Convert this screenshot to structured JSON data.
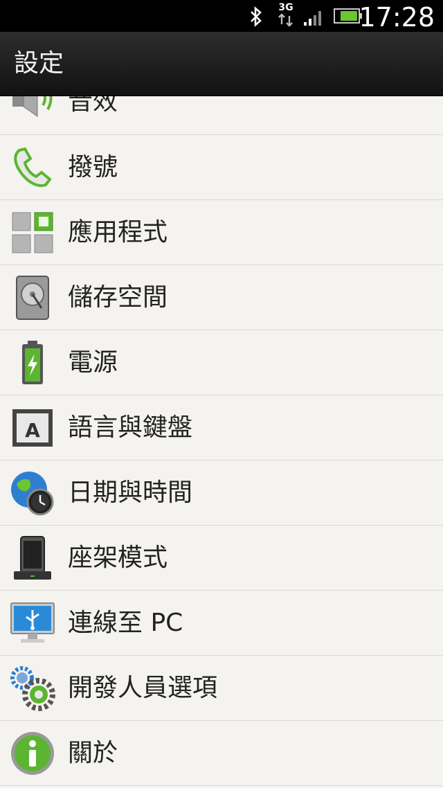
{
  "status": {
    "time": "17:28",
    "network": "3G",
    "icons": [
      "bluetooth-icon",
      "3g-data-icon",
      "signal-icon",
      "battery-icon"
    ]
  },
  "header": {
    "title": "設定"
  },
  "settings": {
    "items": [
      {
        "label": "音效",
        "icon": "speaker-icon"
      },
      {
        "label": "撥號",
        "icon": "phone-icon"
      },
      {
        "label": "應用程式",
        "icon": "apps-grid-icon"
      },
      {
        "label": "儲存空間",
        "icon": "hard-drive-icon"
      },
      {
        "label": "電源",
        "icon": "battery-power-icon"
      },
      {
        "label": "語言與鍵盤",
        "icon": "keyboard-key-icon"
      },
      {
        "label": "日期與時間",
        "icon": "globe-clock-icon"
      },
      {
        "label": "座架模式",
        "icon": "dock-icon"
      },
      {
        "label": "連線至 PC",
        "icon": "usb-monitor-icon"
      },
      {
        "label": "開發人員選項",
        "icon": "gears-icon"
      },
      {
        "label": "關於",
        "icon": "info-icon"
      }
    ]
  },
  "colors": {
    "background": "#f4f3ef",
    "titlebar": "#1e1e1e",
    "accent_green": "#5cb531",
    "text": "#222222"
  }
}
